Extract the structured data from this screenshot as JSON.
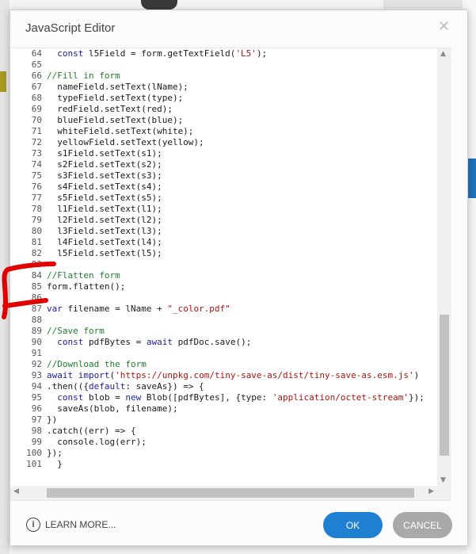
{
  "dialog": {
    "title": "JavaScript Editor",
    "close_icon": "close-icon",
    "learn_more": "LEARN MORE...",
    "ok_label": "OK",
    "cancel_label": "CANCEL"
  },
  "code_lines": [
    {
      "n": "64",
      "t": "  const l5Field = form.getTextField('L5');"
    },
    {
      "n": "65",
      "t": ""
    },
    {
      "n": "66",
      "t": "//Fill in form"
    },
    {
      "n": "67",
      "t": "  nameField.setText(lName);"
    },
    {
      "n": "68",
      "t": "  typeField.setText(type);"
    },
    {
      "n": "69",
      "t": "  redField.setText(red);"
    },
    {
      "n": "70",
      "t": "  blueField.setText(blue);"
    },
    {
      "n": "71",
      "t": "  whiteField.setText(white);"
    },
    {
      "n": "72",
      "t": "  yellowField.setText(yellow);"
    },
    {
      "n": "73",
      "t": "  s1Field.setText(s1);"
    },
    {
      "n": "74",
      "t": "  s2Field.setText(s2);"
    },
    {
      "n": "75",
      "t": "  s3Field.setText(s3);"
    },
    {
      "n": "76",
      "t": "  s4Field.setText(s4);"
    },
    {
      "n": "77",
      "t": "  s5Field.setText(s5);"
    },
    {
      "n": "78",
      "t": "  l1Field.setText(l1);"
    },
    {
      "n": "79",
      "t": "  l2Field.setText(l2);"
    },
    {
      "n": "80",
      "t": "  l3Field.setText(l3);"
    },
    {
      "n": "81",
      "t": "  l4Field.setText(l4);"
    },
    {
      "n": "82",
      "t": "  l5Field.setText(l5);"
    },
    {
      "n": "83",
      "t": ""
    },
    {
      "n": "84",
      "t": "//Flatten form"
    },
    {
      "n": "85",
      "t": "form.flatten();"
    },
    {
      "n": "86",
      "t": ""
    },
    {
      "n": "87",
      "t": "var filename = lName + \"_color.pdf\""
    },
    {
      "n": "88",
      "t": ""
    },
    {
      "n": "89",
      "t": "//Save form"
    },
    {
      "n": "90",
      "t": "  const pdfBytes = await pdfDoc.save();"
    },
    {
      "n": "91",
      "t": ""
    },
    {
      "n": "92",
      "t": "//Download the form"
    },
    {
      "n": "93",
      "t": "await import('https://unpkg.com/tiny-save-as/dist/tiny-save-as.esm.js')"
    },
    {
      "n": "94",
      "t": ".then(({default: saveAs}) => {"
    },
    {
      "n": "95",
      "t": "  const blob = new Blob([pdfBytes], {type: 'application/octet-stream'});"
    },
    {
      "n": "96",
      "t": "  saveAs(blob, filename);"
    },
    {
      "n": "97",
      "t": "})"
    },
    {
      "n": "98",
      "t": ".catch((err) => {"
    },
    {
      "n": "99",
      "t": "  console.log(err);"
    },
    {
      "n": "100",
      "t": "});"
    },
    {
      "n": "101",
      "t": "  }"
    }
  ],
  "colors": {
    "ok": "#1f7fd1",
    "cancel": "#a9a9a9",
    "comment": "#1d7e2c",
    "annotation": "#e00000"
  }
}
